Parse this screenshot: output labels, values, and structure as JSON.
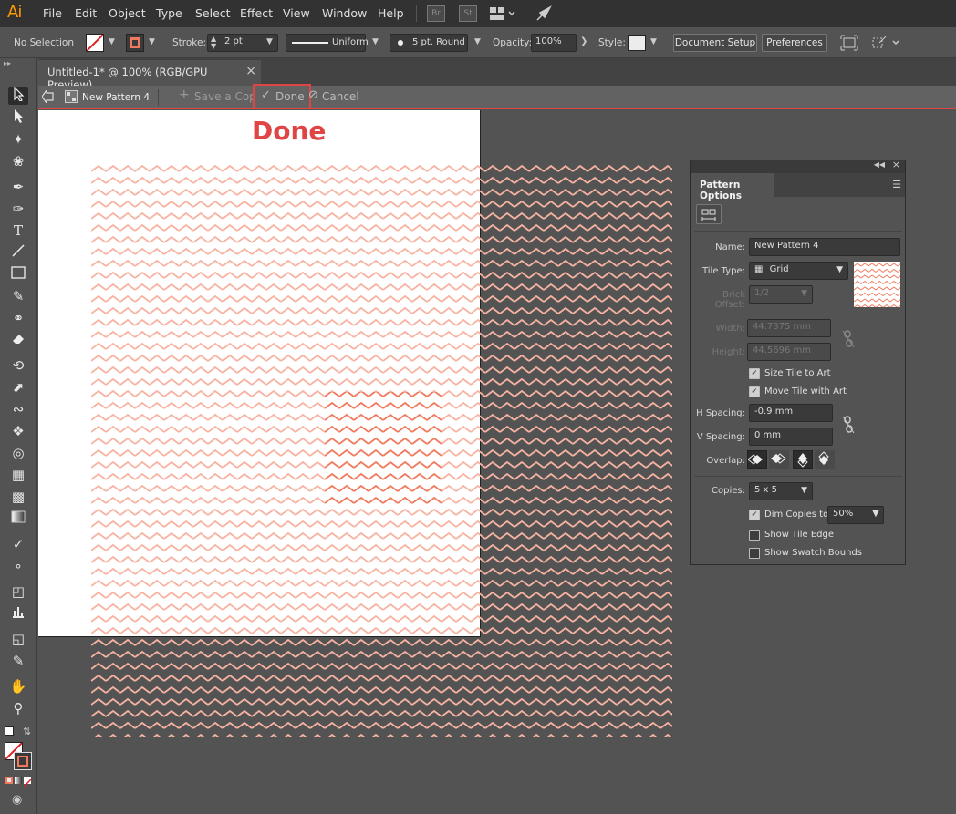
{
  "app": {
    "logo": "Ai",
    "menu": [
      "File",
      "Edit",
      "Object",
      "Type",
      "Select",
      "Effect",
      "View",
      "Window",
      "Help"
    ],
    "bridge": "Br",
    "stock": "St"
  },
  "control": {
    "selection": "No Selection",
    "stroke_label": "Stroke:",
    "stroke_weight": "2 pt",
    "profile": "Uniform",
    "brush": "5 pt. Round",
    "opacity_label": "Opacity:",
    "opacity": "100%",
    "style_label": "Style:",
    "document_setup": "Document Setup",
    "preferences": "Preferences"
  },
  "document": {
    "tab_title": "Untitled-1* @ 100% (RGB/GPU Preview)",
    "close": "×"
  },
  "pattern_bar": {
    "name": "New Pattern 4",
    "save_copy": "Save a Copy",
    "done": "Done",
    "cancel": "Cancel"
  },
  "annotation": {
    "text": "Done",
    "color": "#e04545"
  },
  "panel": {
    "title": "Pattern Options",
    "name_label": "Name:",
    "name_value": "New Pattern 4",
    "tile_type_label": "Tile Type:",
    "tile_type": "Grid",
    "brick_offset_label": "Brick Offset:",
    "brick_offset": "1/2",
    "width_label": "Width:",
    "width": "44.7375 mm",
    "height_label": "Height:",
    "height": "44.5696 mm",
    "size_tile": "Size Tile to Art",
    "move_tile": "Move Tile with Art",
    "hspacing_label": "H Spacing:",
    "hspacing": "-0.9 mm",
    "vspacing_label": "V Spacing:",
    "vspacing": "0 mm",
    "overlap_label": "Overlap:",
    "copies_label": "Copies:",
    "copies": "5 x 5",
    "dim_copies": "Dim Copies to:",
    "dim_value": "50%",
    "show_tile_edge": "Show Tile Edge",
    "show_swatch_bounds": "Show Swatch Bounds"
  },
  "colors": {
    "accent": "#e04545",
    "pattern": "#f07a5e",
    "pattern_dim": "#f7b3a1"
  }
}
